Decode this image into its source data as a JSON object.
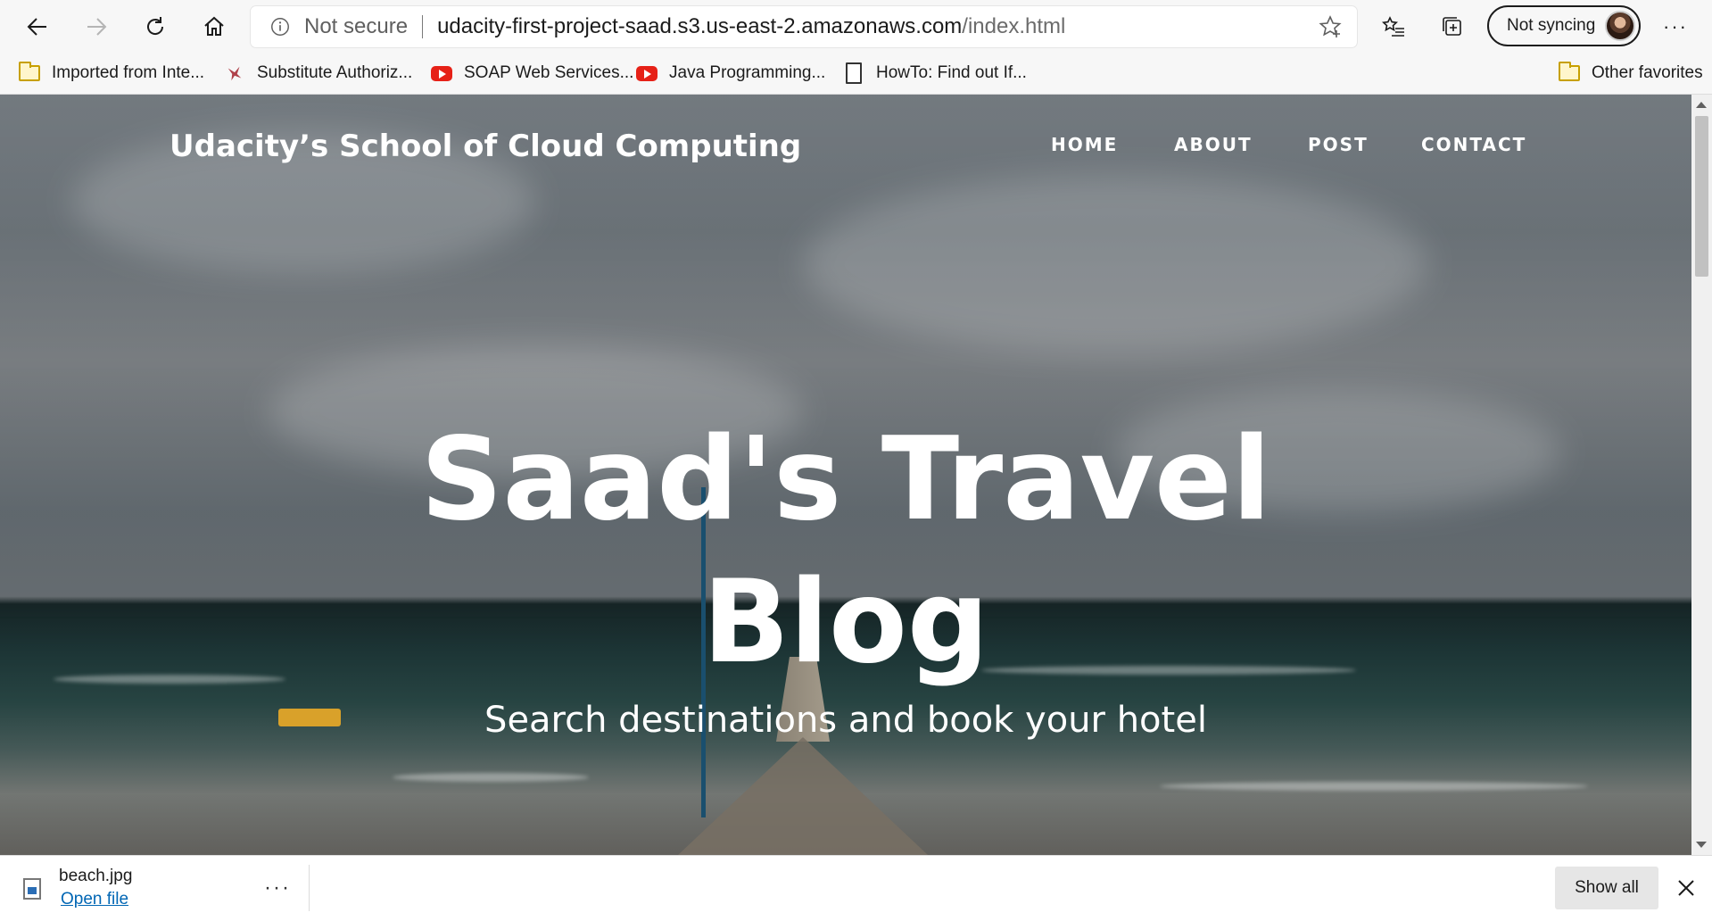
{
  "browser": {
    "security_label": "Not secure",
    "url_domain": "udacity-first-project-saad.s3.us-east-2.amazonaws.com",
    "url_path": "/index.html",
    "profile_label": "Not syncing",
    "more_label": "···"
  },
  "favorites": {
    "items": [
      {
        "label": "Imported from Inte...",
        "icon": "folder-icon"
      },
      {
        "label": "Substitute Authoriz...",
        "icon": "bird-icon"
      },
      {
        "label": "SOAP Web Services...",
        "icon": "youtube-icon"
      },
      {
        "label": "Java Programming...",
        "icon": "youtube-icon"
      },
      {
        "label": "HowTo: Find out If...",
        "icon": "document-icon"
      }
    ],
    "other": "Other favorites"
  },
  "page": {
    "site_title": "Udacity’s School of Cloud Computing",
    "nav": [
      "HOME",
      "ABOUT",
      "POST",
      "CONTACT"
    ],
    "hero_line1": "Saad's Travel",
    "hero_line2": "Blog",
    "hero_subtitle": "Search destinations and book your hotel"
  },
  "download": {
    "filename": "beach.jpg",
    "open_label": "Open file",
    "more_label": "···",
    "show_all": "Show all"
  }
}
